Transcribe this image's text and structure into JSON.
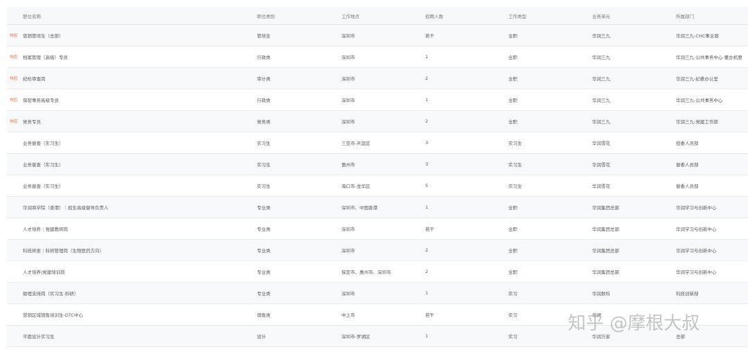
{
  "columns": {
    "name": "职位名称",
    "category": "职位类别",
    "location": "工作地点",
    "headcount": "招聘人数",
    "type": "工作类型",
    "unit": "业务单元",
    "dept": "所属部门"
  },
  "hot_label": "热招",
  "rows": [
    {
      "hot": true,
      "name": "营销管培生（总部）",
      "category": "管培生",
      "location": "深圳市",
      "headcount": "若干",
      "type": "全职",
      "unit": "华润三九",
      "dept": "华润三九-CHC事业部"
    },
    {
      "hot": true,
      "name": "档案管理（高级）专员",
      "category": "行政类",
      "location": "深圳市",
      "headcount": "1",
      "type": "全职",
      "unit": "华润三九",
      "dept": "华润三九-公共事务中心-董办机要"
    },
    {
      "hot": true,
      "name": "纪检审查岗",
      "category": "审计类",
      "location": "深圳市",
      "headcount": "2",
      "type": "全职",
      "unit": "华润三九",
      "dept": "华润三九-纪委办公室"
    },
    {
      "hot": true,
      "name": "保密事务高级专员",
      "category": "行政类",
      "location": "深圳市",
      "headcount": "1",
      "type": "全职",
      "unit": "华润三九",
      "dept": "华润三九-公共事务中心"
    },
    {
      "hot": true,
      "name": "党务专员",
      "category": "党务类",
      "location": "深圳市",
      "headcount": "2",
      "type": "全职",
      "unit": "华润三九",
      "dept": "华润三九-党建工作部"
    },
    {
      "hot": false,
      "name": "业务督查（实习生）",
      "category": "实习生",
      "location": "三亚市-天涯区",
      "headcount": "3",
      "type": "实习生",
      "unit": "华润雪花",
      "dept": "招委人员部"
    },
    {
      "hot": false,
      "name": "业务督查（实习生）",
      "category": "实习生",
      "location": "儋州市",
      "headcount": "3",
      "type": "实习生",
      "unit": "华润雪花",
      "dept": "督委人员部"
    },
    {
      "hot": false,
      "name": "业务督查（实习生）",
      "category": "实习生",
      "location": "海口市-龙华区",
      "headcount": "5",
      "type": "实习生",
      "unit": "华润雪花",
      "dept": "督委人员部"
    },
    {
      "hot": false,
      "name": "华润商学院（香港）｜招生高级督导负责人",
      "category": "专业类",
      "location": "深圳市、中国香港",
      "headcount": "1",
      "type": "全职",
      "unit": "华润集团总部",
      "dept": "华润学习与创新中心"
    },
    {
      "hot": false,
      "name": "人才培养｜党建教研岗",
      "category": "专业类",
      "location": "深圳市",
      "headcount": "若干",
      "type": "全职",
      "unit": "华润集团总部",
      "dept": "华润学习与创新中心"
    },
    {
      "hot": false,
      "name": "科技研发｜科研管理岗（生物医药方向）",
      "category": "专业类",
      "location": "深圳市",
      "headcount": "2",
      "type": "全职",
      "unit": "华润集团总部",
      "dept": "华润学习与创新中心"
    },
    {
      "hot": false,
      "name": "人才培养|党建培训岗",
      "category": "专业类",
      "location": "保定市、惠州市、深圳市",
      "headcount": "2",
      "type": "全职",
      "unit": "华润集团总部",
      "dept": "华润学习与创新中心"
    },
    {
      "hot": false,
      "name": "助理支持岗（实习生-科研）",
      "category": "专业类",
      "location": "深圳市",
      "headcount": "1",
      "type": "实习",
      "unit": "华润数科",
      "dept": "科技创新部"
    },
    {
      "hot": false,
      "name": "营销区域销售培训生-DTC中心",
      "category": "销售类",
      "location": "中上市",
      "headcount": "若干",
      "type": "实习",
      "unit": "华润",
      "dept": ""
    },
    {
      "hot": false,
      "name": "平面设计实习生",
      "category": "设计",
      "location": "深圳市-罗湖区",
      "headcount": "1",
      "type": "实习",
      "unit": "华润万家",
      "dept": "总部"
    }
  ],
  "watermark": "知乎 @摩根大叔"
}
